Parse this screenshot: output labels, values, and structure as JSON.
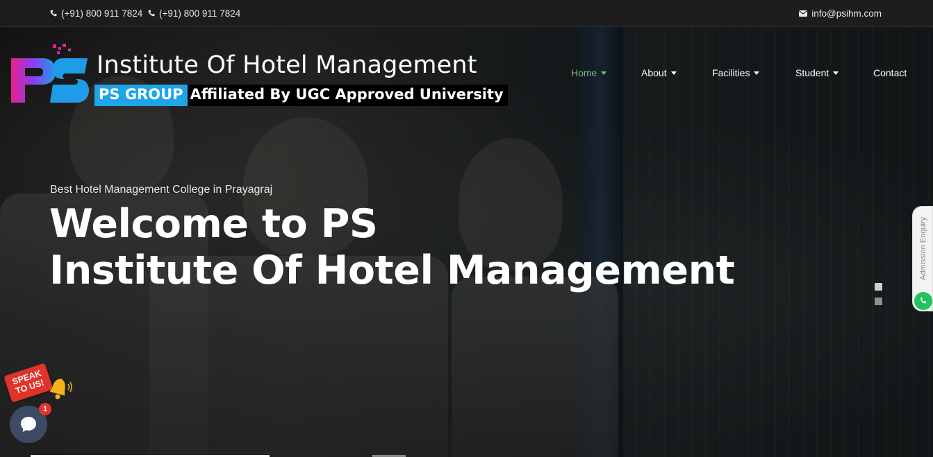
{
  "topbar": {
    "phone1": "(+91) 800 911 7824",
    "phone2": "(+91) 800 911 7824",
    "email": "info@psihm.com"
  },
  "logo": {
    "mark_text": "PS",
    "title": "Institute Of Hotel Management",
    "group": "PS GROUP",
    "affiliation": "Affiliated By UGC Approved University"
  },
  "nav": {
    "items": [
      {
        "label": "Home",
        "active": true,
        "dropdown": true
      },
      {
        "label": "About",
        "active": false,
        "dropdown": true
      },
      {
        "label": "Facilities",
        "active": false,
        "dropdown": true
      },
      {
        "label": "Student",
        "active": false,
        "dropdown": true
      },
      {
        "label": "Contact",
        "active": false,
        "dropdown": false
      }
    ]
  },
  "hero": {
    "subtitle": "Best Hotel Management College in Prayagraj",
    "headline_line1": "Welcome to PS",
    "headline_line2": "Institute Of Hotel Management"
  },
  "side_tab": {
    "label": "Admission Enquiry"
  },
  "speak": {
    "line1": "SPEAK",
    "line2": "TO US!"
  },
  "chat": {
    "badge_count": "1"
  },
  "colors": {
    "nav_active": "#6fc172",
    "group_strip": "#1ea5e8",
    "speak_tag": "#e0342b",
    "whatsapp": "#22c35e",
    "chat_bubble": "#3d4a63"
  }
}
